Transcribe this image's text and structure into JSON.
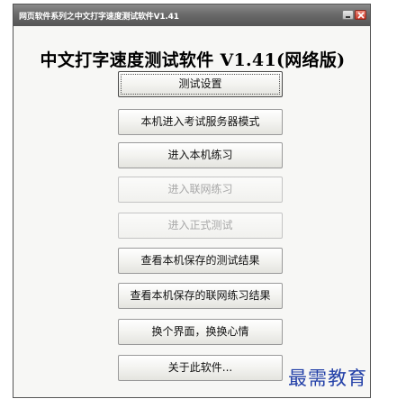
{
  "window": {
    "title": "网页软件系列之中文打字速度测试软件V1.41",
    "minimize_icon": "minimize-icon",
    "close_icon": "close-icon"
  },
  "app": {
    "heading": "中文打字速度测试软件 V1.41(网络版)"
  },
  "buttons": [
    {
      "label": "测试设置",
      "enabled": true,
      "focused": true
    },
    {
      "label": "本机进入考试服务器模式",
      "enabled": true
    },
    {
      "label": "进入本机练习",
      "enabled": true
    },
    {
      "label": "进入联网练习",
      "enabled": false
    },
    {
      "label": "进入正式测试",
      "enabled": false
    },
    {
      "label": "查看本机保存的测试结果",
      "enabled": true
    },
    {
      "label": "查看本机保存的联网练习结果",
      "enabled": true
    },
    {
      "label": "换个界面，换换心情",
      "enabled": true
    },
    {
      "label": "关于此软件...",
      "enabled": true
    }
  ],
  "watermark": {
    "text": "最需教育"
  },
  "colors": {
    "titlebar": "#6a6a6a",
    "window_bg": "#f7f7f5",
    "disabled_text": "#a8a8a8",
    "watermark": "#2340a8"
  }
}
